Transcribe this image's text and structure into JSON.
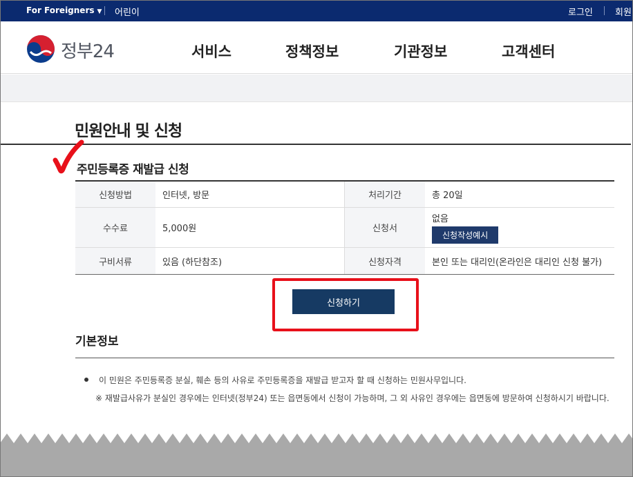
{
  "topbar": {
    "for_foreigners": "For Foreigners",
    "children": "어린이",
    "login": "로그인",
    "member": "회원"
  },
  "header": {
    "logo_text": "정부24",
    "nav": [
      "서비스",
      "정책정보",
      "기관정보",
      "고객센터"
    ]
  },
  "page_title": "민원안내 및 신청",
  "section_title": "주민등록증 재발급 신청",
  "info": {
    "method_label": "신청방법",
    "method_value": "인터넷, 방문",
    "period_label": "처리기간",
    "period_value": "총 20일",
    "fee_label": "수수료",
    "fee_value": "5,000원",
    "form_label": "신청서",
    "form_value": "없음",
    "form_example_button": "신청작성예시",
    "docs_label": "구비서류",
    "docs_value": "있음 (하단참조)",
    "qualification_label": "신청자격",
    "qualification_value": "본인 또는 대리인(온라인은 대리인 신청 불가)"
  },
  "apply_button": "신청하기",
  "basic_info": {
    "title": "기본정보",
    "description": "이 민원은 주민등록증 분실, 훼손 등의 사유로 주민등록증을 재발급 받고자 할 때 신청하는 민원사무입니다.",
    "note": "※ 재발급사유가 분실인 경우에는 인터넷(정부24) 또는 읍면동에서 신청이 가능하며, 그 외 사유인 경우에는 읍면동에 방문하여 신청하시기 바랍니다."
  },
  "colors": {
    "topbar": "#0b2a6f",
    "apply_button": "#163a63",
    "highlight": "#e8101a",
    "checkmark": "#e8101a"
  }
}
